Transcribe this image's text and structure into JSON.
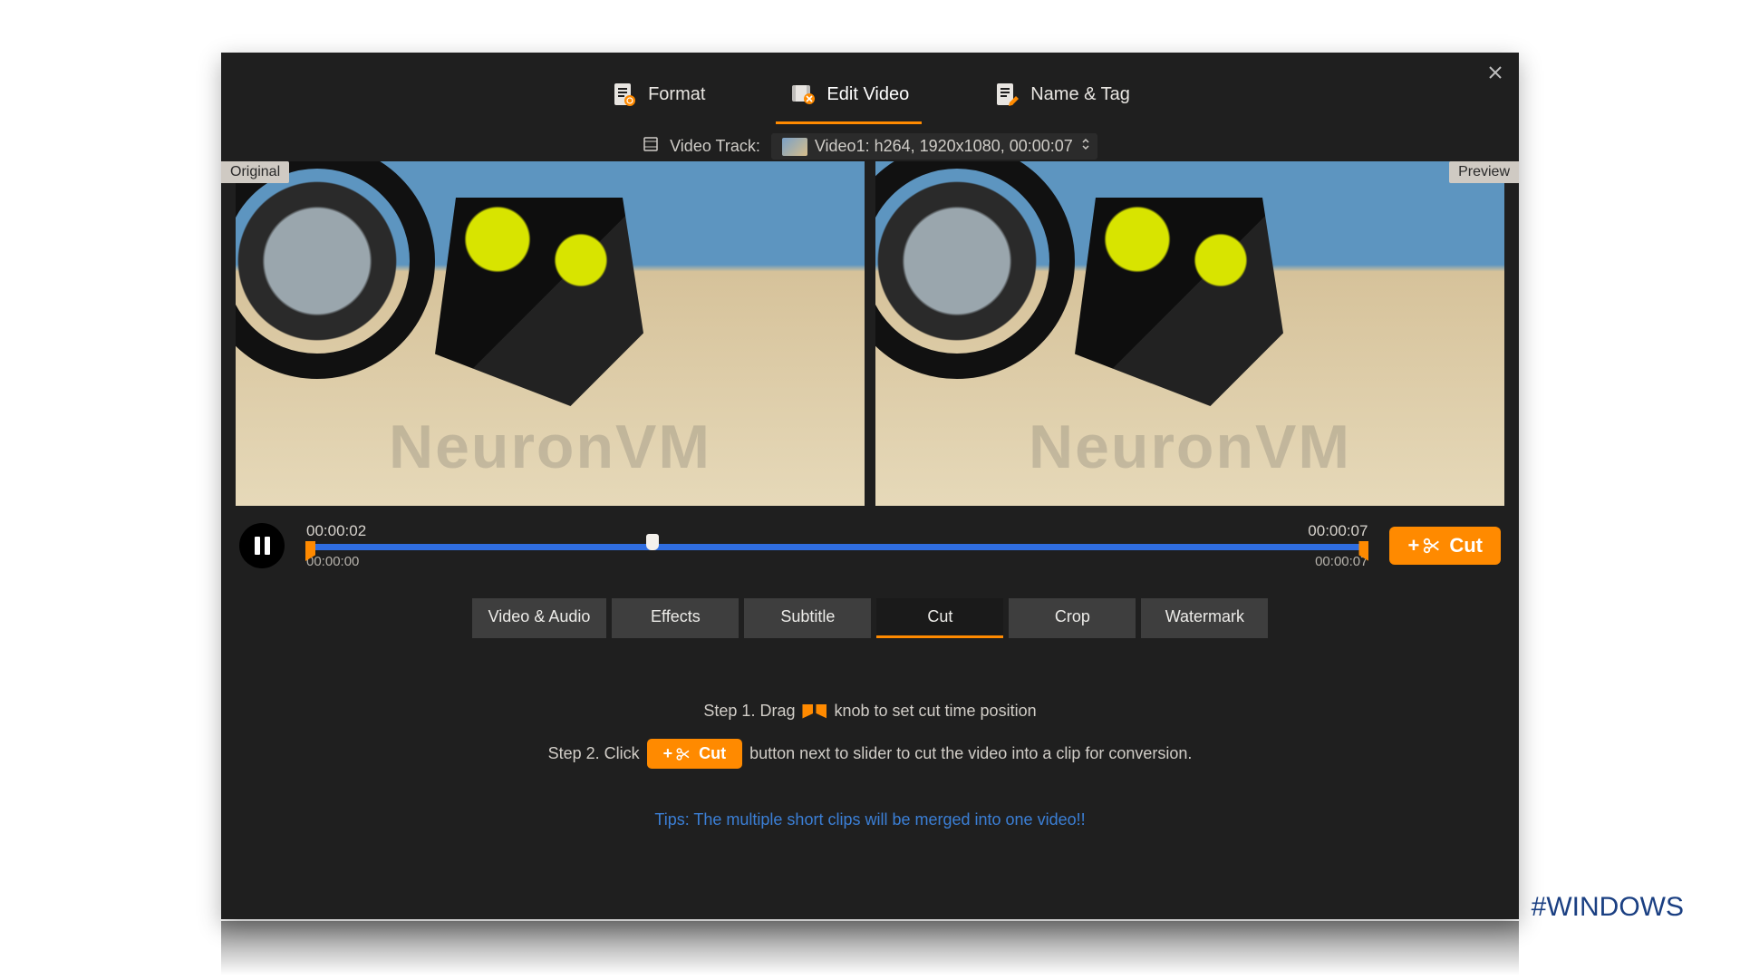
{
  "tabs": {
    "format": "Format",
    "edit_video": "Edit Video",
    "name_tag": "Name & Tag"
  },
  "video_track": {
    "label": "Video Track:",
    "selected": "Video1: h264, 1920x1080, 00:00:07"
  },
  "labels": {
    "original": "Original",
    "preview": "Preview"
  },
  "timeline": {
    "current": "00:00:02",
    "total": "00:00:07",
    "range_start": "00:00:00",
    "range_end": "00:00:07"
  },
  "cut_button": "Cut",
  "sub_tabs": {
    "video_audio": "Video & Audio",
    "effects": "Effects",
    "subtitle": "Subtitle",
    "cut": "Cut",
    "crop": "Crop",
    "watermark": "Watermark"
  },
  "steps": {
    "step1_a": "Step 1. Drag",
    "step1_b": "knob to set cut time position",
    "step2_a": "Step 2. Click",
    "step2_cut": "Cut",
    "step2_b": "button next to slider to cut the video into a clip for conversion."
  },
  "tips": "Tips: The multiple short clips will be merged into one video!!",
  "watermark_text": "NeuronVM",
  "hashtag": "#WINDOWS"
}
